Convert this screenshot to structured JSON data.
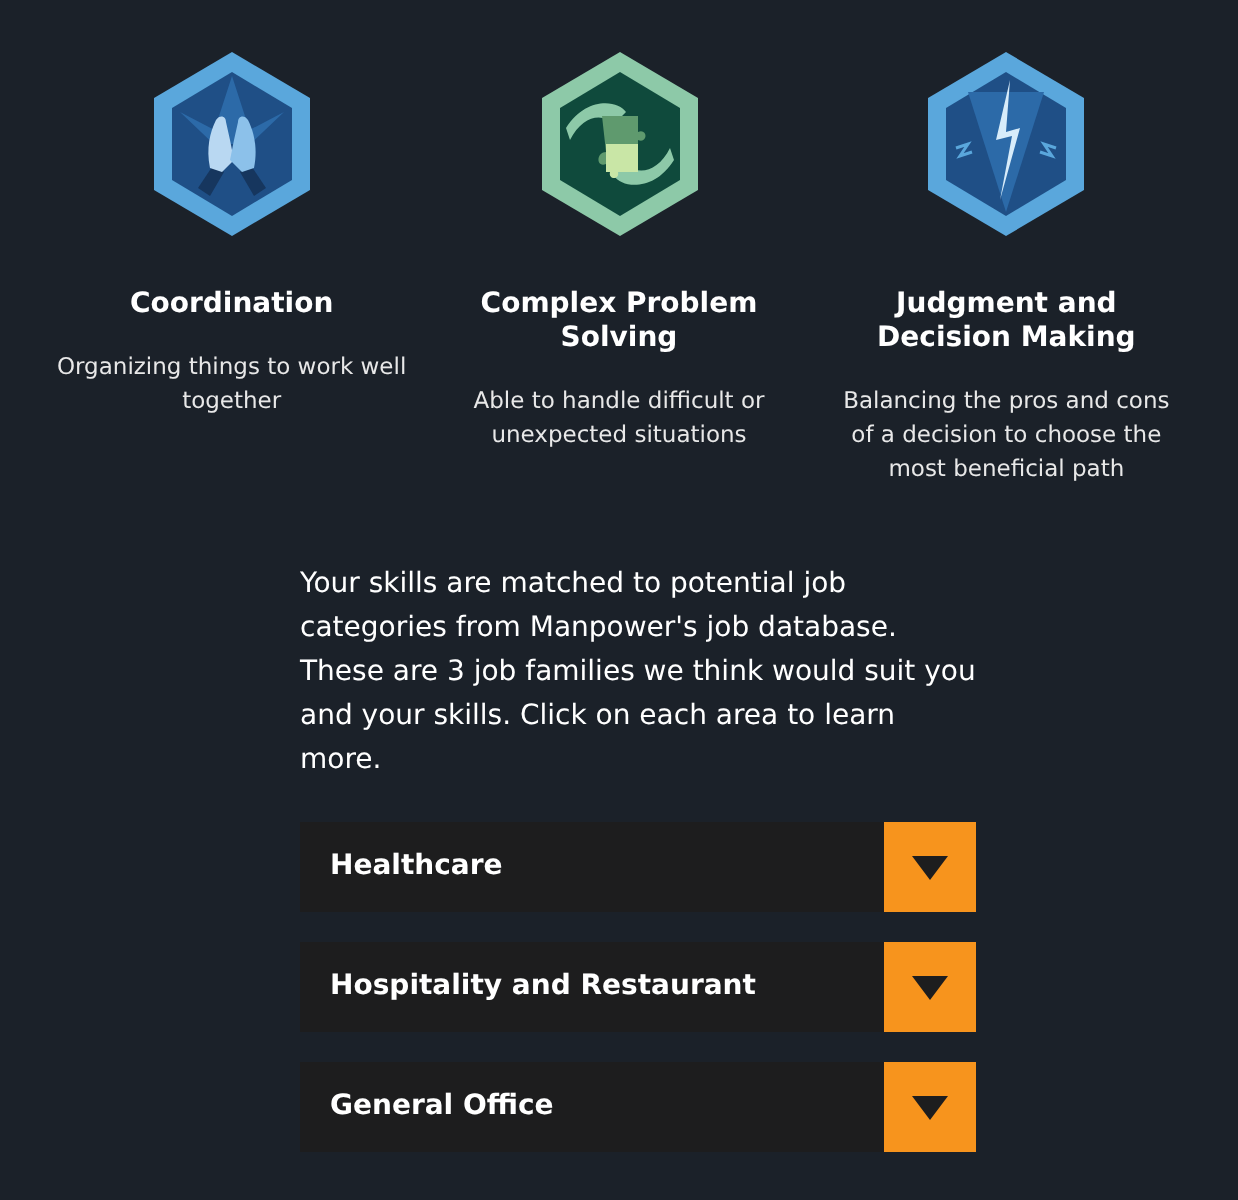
{
  "skills": [
    {
      "kind": "hands",
      "title": "Coordination",
      "description": "Organizing things to work well together"
    },
    {
      "kind": "puzzle",
      "title": "Complex Problem Solving",
      "description": "Able to handle difficult or unexpected situations"
    },
    {
      "kind": "lightning",
      "title": "Judgment and Decision Making",
      "description": "Balancing the pros and cons of a decision to choose the most beneficial path"
    }
  ],
  "intro": "Your skills are matched to potential job categories from Manpower's job database. These are 3 job families we think would suit you and your skills. Click on each area to learn more.",
  "job_families": [
    {
      "label": "Healthcare",
      "expanded": false
    },
    {
      "label": "Hospitality and Restaurant",
      "expanded": false
    },
    {
      "label": "General Office",
      "expanded": false
    }
  ]
}
